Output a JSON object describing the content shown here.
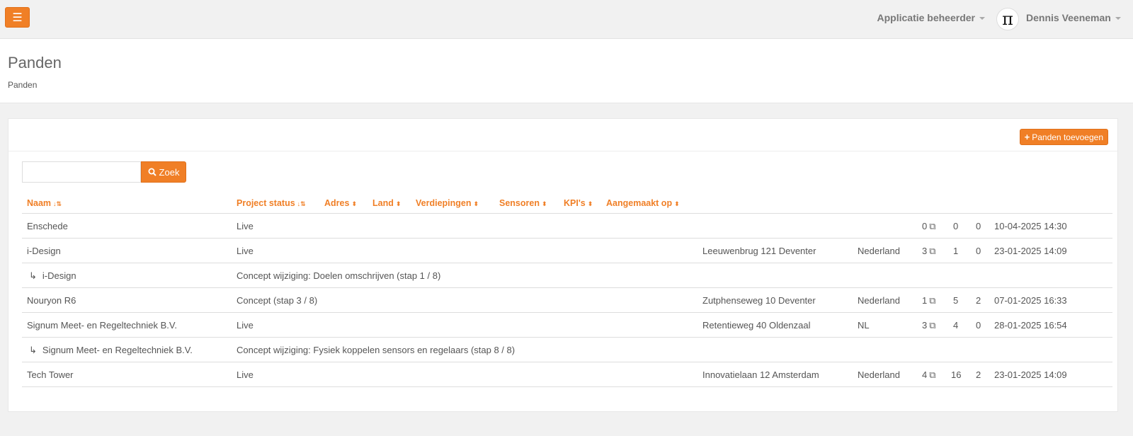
{
  "topbar": {
    "menu_icon": "hamburger-icon",
    "role_label": "Applicatie beheerder",
    "avatar_glyph": "π",
    "user_name": "Dennis Veeneman"
  },
  "page": {
    "title": "Panden",
    "breadcrumb": "Panden"
  },
  "toolbar": {
    "add_label": "Panden toevoegen",
    "add_icon": "plus-icon"
  },
  "search": {
    "value": "",
    "placeholder": "",
    "button_label": "Zoek",
    "button_icon": "search-icon"
  },
  "table": {
    "columns": [
      {
        "label": "Naam",
        "sort": "sorted"
      },
      {
        "label": "Project status",
        "sort": "sorted"
      },
      {
        "label": "Adres",
        "sort": "both"
      },
      {
        "label": "Land",
        "sort": "both"
      },
      {
        "label": "Verdiepingen",
        "sort": "both"
      },
      {
        "label": "Sensoren",
        "sort": "both"
      },
      {
        "label": "KPI's",
        "sort": "both"
      },
      {
        "label": "Aangemaakt op",
        "sort": "both"
      }
    ],
    "rows": [
      {
        "child": false,
        "naam": "Enschede",
        "status": "Live",
        "adres": "",
        "land": "",
        "verdiepingen": "0",
        "sensoren": "0",
        "kpis": "0",
        "aangemaakt": "10-04-2025 14:30"
      },
      {
        "child": false,
        "naam": "i-Design",
        "status": "Live",
        "adres": "Leeuwenbrug 121 Deventer",
        "land": "Nederland",
        "verdiepingen": "3",
        "sensoren": "1",
        "kpis": "0",
        "aangemaakt": "23-01-2025 14:09"
      },
      {
        "child": true,
        "naam": "i-Design",
        "status": "Concept wijziging: Doelen omschrijven (stap 1 / 8)",
        "adres": "",
        "land": "",
        "verdiepingen": "",
        "sensoren": "",
        "kpis": "",
        "aangemaakt": ""
      },
      {
        "child": false,
        "naam": "Nouryon R6",
        "status": "Concept (stap 3 / 8)",
        "adres": "Zutphenseweg 10 Deventer",
        "land": "Nederland",
        "verdiepingen": "1",
        "sensoren": "5",
        "kpis": "2",
        "aangemaakt": "07-01-2025 16:33"
      },
      {
        "child": false,
        "naam": "Signum Meet- en Regeltechniek B.V.",
        "status": "Live",
        "adres": "Retentieweg 40 Oldenzaal",
        "land": "NL",
        "verdiepingen": "3",
        "sensoren": "4",
        "kpis": "0",
        "aangemaakt": "28-01-2025 16:54"
      },
      {
        "child": true,
        "naam": "Signum Meet- en Regeltechniek B.V.",
        "status": "Concept wijziging: Fysiek koppelen sensors en regelaars (stap 8 / 8)",
        "adres": "",
        "land": "",
        "verdiepingen": "",
        "sensoren": "",
        "kpis": "",
        "aangemaakt": ""
      },
      {
        "child": false,
        "naam": "Tech Tower",
        "status": "Live",
        "adres": "Innovatielaan 12 Amsterdam",
        "land": "Nederland",
        "verdiepingen": "4",
        "sensoren": "16",
        "kpis": "2",
        "aangemaakt": "23-01-2025 14:09"
      }
    ]
  },
  "colors": {
    "accent": "#f07f26",
    "text": "#555555",
    "background": "#f1f1f1"
  }
}
